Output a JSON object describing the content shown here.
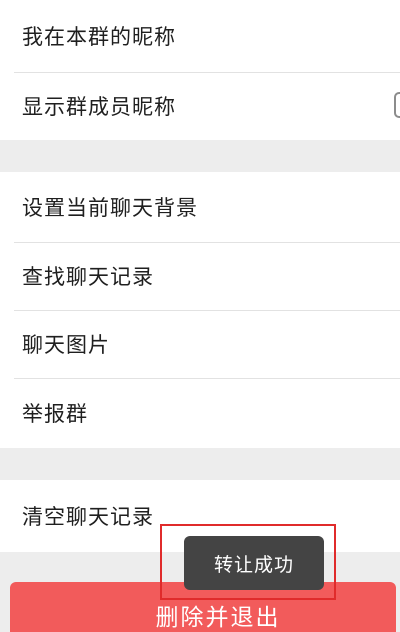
{
  "settings": {
    "group1": {
      "my_nickname": "我在本群的昵称",
      "show_nicknames": "显示群成员昵称"
    },
    "group2": {
      "set_background": "设置当前聊天背景",
      "search_history": "查找聊天记录",
      "chat_images": "聊天图片",
      "report_group": "举报群"
    },
    "group3": {
      "clear_history": "清空聊天记录"
    }
  },
  "actions": {
    "delete_exit": "删除并退出"
  },
  "toast": {
    "message": "转让成功"
  },
  "colors": {
    "danger": "#f25b5b",
    "toast_bg": "#444444",
    "highlight": "#e02b2b",
    "background": "#ededed"
  },
  "icons": {
    "show_nicknames_toggle": "toggle-switch-icon"
  }
}
